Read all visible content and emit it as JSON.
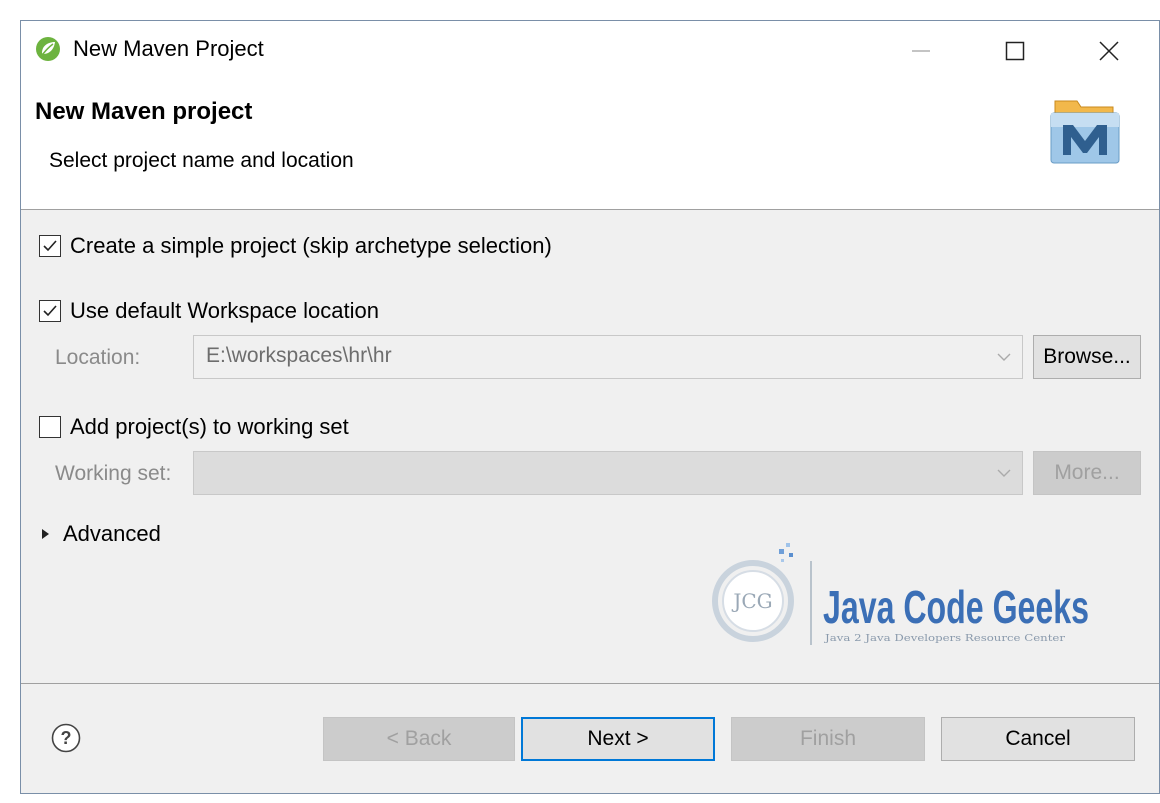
{
  "window": {
    "title": "New Maven Project",
    "controls": [
      "minimize",
      "maximize",
      "close"
    ]
  },
  "banner": {
    "title": "New Maven project",
    "subtitle": "Select project name and location",
    "icon": "maven-icon"
  },
  "options": {
    "simple_project": {
      "label": "Create a simple project (skip archetype selection)",
      "checked": true
    },
    "default_workspace": {
      "label": "Use default Workspace location",
      "checked": true
    },
    "location": {
      "label": "Location:",
      "value": "E:\\workspaces\\hr\\hr",
      "browse_label": "Browse..."
    },
    "working_set_toggle": {
      "label": "Add project(s) to working set",
      "checked": false
    },
    "working_set": {
      "label": "Working set:",
      "value": "",
      "more_label": "More..."
    },
    "advanced": {
      "label": "Advanced",
      "expanded": false
    }
  },
  "watermark": {
    "badge": "JCG",
    "title": "Java Code Geeks",
    "tagline": "Java 2 Java Developers Resource Center"
  },
  "footer": {
    "help_icon": "help-icon",
    "back_label": "< Back",
    "next_label": "Next >",
    "finish_label": "Finish",
    "cancel_label": "Cancel"
  },
  "colors": {
    "accent": "#0078d7",
    "dialog_bg": "#f0f0f0",
    "watermark_blue": "#3b6fb6"
  }
}
